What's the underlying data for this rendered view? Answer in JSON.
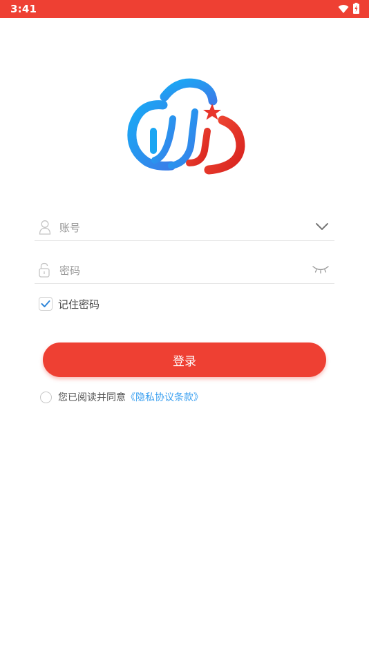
{
  "status_bar": {
    "time": "3:41",
    "wifi_icon": "wifi-icon",
    "battery_icon": "battery-charging-icon"
  },
  "logo": {
    "icon": "cloud-logo-icon",
    "colors": {
      "blue": "#1ea1f2",
      "red": "#e8342a"
    }
  },
  "account": {
    "placeholder": "账号",
    "value": "",
    "icon": "user-icon",
    "dropdown_icon": "chevron-down-icon"
  },
  "password": {
    "placeholder": "密码",
    "value": "",
    "icon": "lock-icon",
    "toggle_icon": "eye-closed-icon"
  },
  "remember": {
    "label": "记住密码",
    "checked": true
  },
  "login": {
    "label": "登录"
  },
  "agreement": {
    "text": "您已阅读并同意",
    "link": "《隐私协议条款》",
    "checked": false
  },
  "colors": {
    "accent": "#ee4033",
    "link": "#3ba0f0"
  }
}
